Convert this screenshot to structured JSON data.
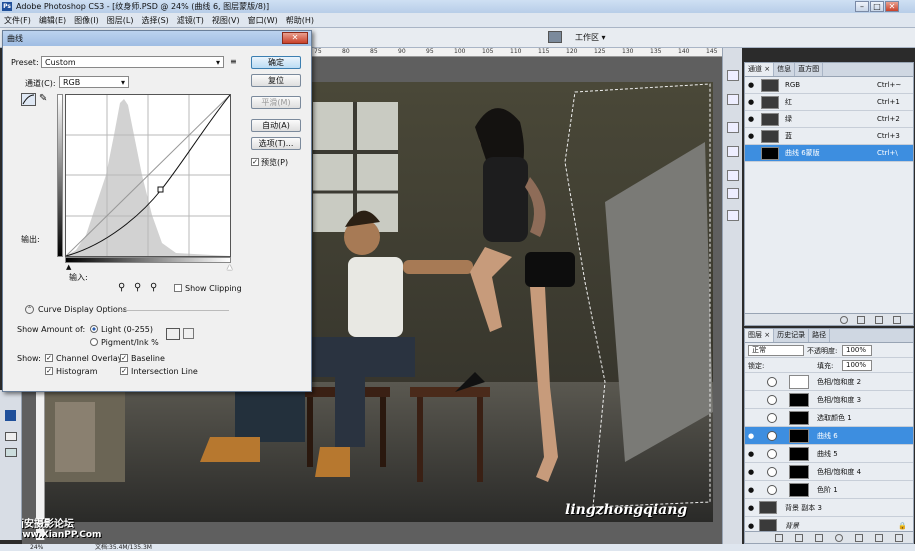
{
  "window": {
    "title": "Adobe Photoshop CS3 - [纹身师.PSD @ 24% (曲线 6, 图层蒙版/8)]",
    "logo": "Ps"
  },
  "menu": [
    "文件(F)",
    "编辑(E)",
    "图像(I)",
    "图层(L)",
    "选择(S)",
    "滤镜(T)",
    "视图(V)",
    "窗口(W)",
    "帮助(H)"
  ],
  "toolbar": {
    "workspace_label": "工作区 ▾"
  },
  "ruler": {
    "ticks": [
      "75",
      "80",
      "85",
      "90",
      "95",
      "100",
      "105",
      "110",
      "115",
      "120",
      "125",
      "130",
      "135",
      "140",
      "145"
    ]
  },
  "status": {
    "zoom": "24%",
    "doc": "文档:35.4M/135.3M"
  },
  "watermark": {
    "photo": "lingzhongqiang",
    "site_cn": "西安摄影论坛",
    "site_url": "www.XianPP.Com"
  },
  "curves": {
    "title": "曲线",
    "close": "✕",
    "preset_label": "Preset:",
    "preset_value": "Custom",
    "channel_label": "通道(C):",
    "channel_value": "RGB",
    "output_label": "输出:",
    "input_label": "输入:",
    "buttons": {
      "ok": "确定",
      "reset": "复位",
      "smooth": "平滑(M)",
      "auto": "自动(A)",
      "options": "选项(T)..."
    },
    "preview_label": "预览(P)",
    "show_clipping": "Show Clipping",
    "display_options": "Curve Display Options",
    "show_amount_label": "Show Amount of:",
    "light": "Light  (0-255)",
    "pigment": "Pigment/Ink %",
    "show_label": "Show:",
    "channel_overlays": "Channel Overlays",
    "baseline": "Baseline",
    "histogram": "Histogram",
    "intersection_line": "Intersection Line"
  },
  "channels_panel": {
    "tabs": [
      "通道 ×",
      "信息",
      "直方图"
    ],
    "rows": [
      {
        "name": "RGB",
        "key": "Ctrl+~"
      },
      {
        "name": "红",
        "key": "Ctrl+1"
      },
      {
        "name": "绿",
        "key": "Ctrl+2"
      },
      {
        "name": "蓝",
        "key": "Ctrl+3"
      },
      {
        "name": "曲线 6蒙版",
        "key": "Ctrl+\\"
      }
    ]
  },
  "layers_panel": {
    "tabs": [
      "图层 ×",
      "历史记录",
      "路径"
    ],
    "blend_mode": "正常",
    "opacity_label": "不透明度:",
    "opacity": "100%",
    "lock_label": "锁定:",
    "fill_label": "填充:",
    "fill": "100%",
    "rows": [
      {
        "name": "色相/饱和度 2"
      },
      {
        "name": "色相/饱和度 3"
      },
      {
        "name": "选取颜色 1"
      },
      {
        "name": "曲线 6"
      },
      {
        "name": "曲线 5"
      },
      {
        "name": "色相/饱和度 4"
      },
      {
        "name": "色阶 1"
      },
      {
        "name": "背景 副本 3"
      },
      {
        "name": "背景"
      }
    ]
  },
  "colors": {
    "selection": "#3d8ee0",
    "accent": "#3c7fb1"
  }
}
